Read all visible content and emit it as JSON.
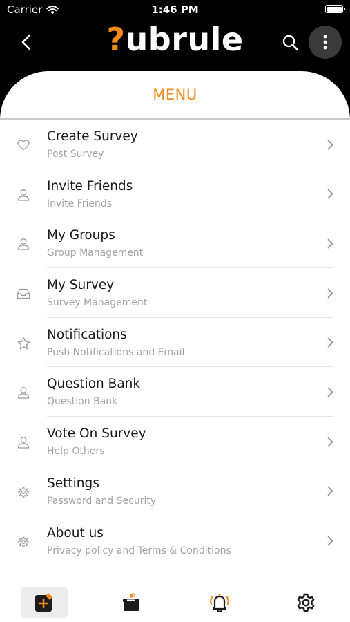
{
  "status_bar": {
    "carrier": "Carrier",
    "time": "1:46 PM"
  },
  "header": {
    "logo_mark": "?",
    "logo_text": "ubrule",
    "back_icon": "chevron-left-icon",
    "search_icon": "search-icon",
    "more_icon": "more-vertical-icon"
  },
  "menu": {
    "title": "MENU",
    "items": [
      {
        "title": "Create Survey",
        "subtitle": "Post Survey",
        "icon": "heart-icon"
      },
      {
        "title": "Invite Friends",
        "subtitle": "Invite Friends",
        "icon": "user-icon"
      },
      {
        "title": "My Groups",
        "subtitle": "Group Management",
        "icon": "user-icon"
      },
      {
        "title": "My Survey",
        "subtitle": "Survey Management",
        "icon": "inbox-icon"
      },
      {
        "title": "Notifications",
        "subtitle": "Push Notifications and Email",
        "icon": "star-icon"
      },
      {
        "title": "Question Bank",
        "subtitle": "Question Bank",
        "icon": "user-icon"
      },
      {
        "title": "Vote On Survey",
        "subtitle": "Help Others",
        "icon": "user-icon"
      },
      {
        "title": "Settings",
        "subtitle": "Password and Security",
        "icon": "gear-icon"
      },
      {
        "title": "About us",
        "subtitle": "Privacy policy and Terms & Conditions",
        "icon": "gear-icon"
      }
    ]
  },
  "tab_bar": {
    "tabs": [
      {
        "icon": "new-survey-icon",
        "active": true
      },
      {
        "icon": "ballot-box-icon",
        "active": false
      },
      {
        "icon": "bell-icon",
        "active": false
      },
      {
        "icon": "gear-icon",
        "active": false
      }
    ]
  },
  "colors": {
    "accent": "#f28a1c",
    "header_bg": "#000000",
    "sheet_bg": "#ffffff"
  }
}
